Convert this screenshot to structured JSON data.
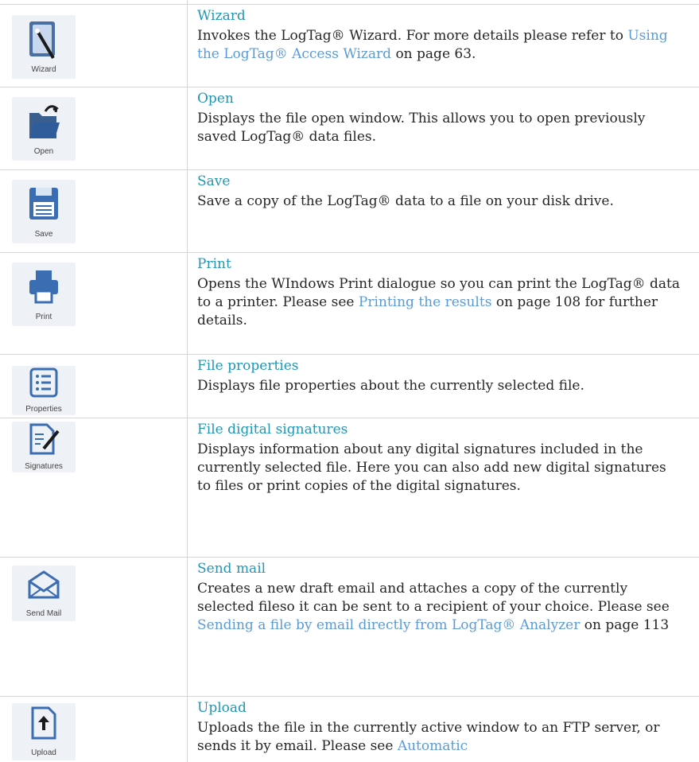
{
  "rows": [
    {
      "icon": "wizard-icon",
      "icon_label": "Wizard",
      "title": "Wizard",
      "desc_before": "Invokes the LogTag® Wizard. For more details please refer to ",
      "link": "Using the LogTag® Access Wizard",
      "desc_after": " on page 63."
    },
    {
      "icon": "folder-open-icon",
      "icon_label": "Open",
      "title": "Open",
      "desc": "Displays the file open window. This allows you to open previously saved LogTag® data files."
    },
    {
      "icon": "floppy-disk-icon",
      "icon_label": "Save",
      "title": "Save",
      "desc": "Save a copy of the LogTag® data to a file on your disk drive."
    },
    {
      "icon": "printer-icon",
      "icon_label": "Print",
      "title": "Print",
      "desc_before": "Opens the WIndows Print dialogue so you can print the LogTag® data to a printer. Please see ",
      "link": "Printing the results",
      "desc_after": " on page 108 for further details."
    },
    {
      "icon": "properties-list-icon",
      "icon_label": "Properties",
      "title": "File properties",
      "desc": "Displays file properties about the currently selected file."
    },
    {
      "icon": "signature-document-icon",
      "icon_label": "Signatures",
      "title": "File digital signatures",
      "desc": "Displays information about any digital signatures included in the currently selected file. Here you can also add new digital signatures to files or print copies of the digital signatures."
    },
    {
      "icon": "envelope-icon",
      "icon_label": "Send Mail",
      "title": "Send mail",
      "desc_before": "Creates a new draft email and attaches a copy of the currently selected fileso it can be sent to a recipient of your choice. Please see ",
      "link": "Sending a file by email directly from LogTag® Analyzer",
      "desc_after": " on page 113"
    },
    {
      "icon": "upload-icon",
      "icon_label": "Upload",
      "title": "Upload",
      "desc_before": "Uploads the file in the currently active window to an FTP server, or sends it by email. Please see ",
      "link": "Automatic",
      "desc_after": ""
    }
  ]
}
